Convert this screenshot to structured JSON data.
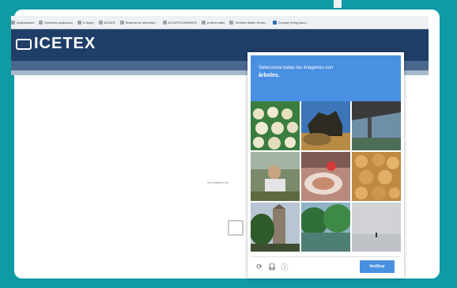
{
  "bookmarks": [
    {
      "label": "Aplicaciones",
      "icon": "apps-icon"
    },
    {
      "label": "Escritorio aplicación",
      "icon": "page-icon"
    },
    {
      "label": "Ir Angel",
      "icon": "page-icon"
    },
    {
      "label": "ACUED",
      "icon": "page-icon"
    },
    {
      "label": "Sistema de Informaci...",
      "icon": "page-icon"
    },
    {
      "label": "ACCEPCIONARIOS",
      "icon": "page-icon"
    },
    {
      "label": "ju tiene sabe",
      "icon": "page-icon"
    },
    {
      "label": "Centros Saber Gener...",
      "icon": "page-icon"
    },
    {
      "label": "Conseg Tering Abre...",
      "icon": "folder-icon"
    }
  ],
  "header": {
    "logo_text": "ICETEX"
  },
  "page": {
    "side_label": "Ver Adeutor Lis"
  },
  "captcha": {
    "instruction": "Selecciona todas las imágenes con",
    "target": "árboles.",
    "verify_label": "Verificar",
    "footer_icons": [
      "reload-icon",
      "audio-icon",
      "info-icon"
    ],
    "tiles": [
      "cakes-tray-image",
      "lion-animal-image",
      "bridge-river-image",
      "people-outdoor-image",
      "food-plate-image",
      "snacks-image",
      "tree-house-image",
      "trees-river-image",
      "beach-fog-image"
    ]
  },
  "colors": {
    "frame": "#0f9aa4",
    "header": "#1f3e68",
    "captcha_blue": "#4a90e2"
  }
}
